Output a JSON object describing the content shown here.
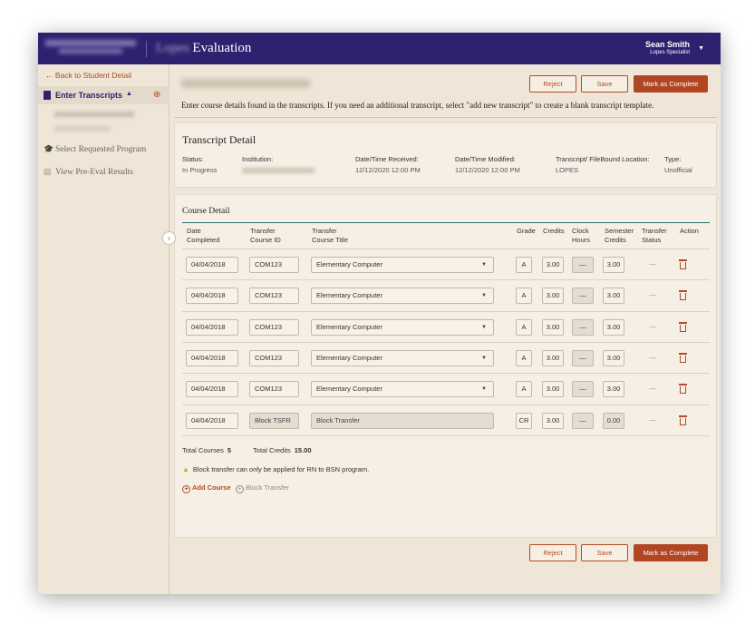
{
  "header": {
    "app_title": "Evaluation",
    "app_title_prefix": "Lopes",
    "user_name": "Sean Smith",
    "user_role": "Lopes Specialist"
  },
  "sidebar": {
    "back_label": "Back to Student Detail",
    "active_item": "Enter Transcripts",
    "items": [
      {
        "label": "Select Requested Program",
        "icon": "graduation-cap-icon"
      },
      {
        "label": "View Pre-Eval Results",
        "icon": "clipboard-icon"
      }
    ]
  },
  "actions": {
    "reject": "Reject",
    "save": "Save",
    "complete": "Mark as Complete"
  },
  "instructions": "Enter course details found in the transcripts. If you need an additional transcript, select \"add new transcript\" to create a blank transcript template.",
  "transcript_detail": {
    "title": "Transcript Detail",
    "fields": {
      "status_label": "Status:",
      "status_value": "In Progress",
      "institution_label": "Institution:",
      "received_label": "Date/Time Received:",
      "received_value": "12/12/2020 12:00 PM",
      "modified_label": "Date/Time Modified:",
      "modified_value": "12/12/2020 12:00 PM",
      "location_label": "Transcript/ FileBound Location:",
      "location_value": "LOPES",
      "type_label": "Type:",
      "type_value": "Unofficial"
    }
  },
  "course_detail": {
    "title": "Course Detail",
    "columns": [
      "Date\nCompleted",
      "Transfer\nCourse ID",
      "Transfer\nCourse Title",
      "Grade",
      "Credits",
      "Clock\nHours",
      "Semester\nCredits",
      "Transfer\nStatus",
      "Action"
    ],
    "rows": [
      {
        "date": "04/04/2018",
        "course_id": "COM123",
        "title": "Elementary Computer",
        "grade": "A",
        "credits": "3.00",
        "clock": "—",
        "semester": "3.00",
        "status": "—"
      },
      {
        "date": "04/04/2018",
        "course_id": "COM123",
        "title": "Elementary Computer",
        "grade": "A",
        "credits": "3.00",
        "clock": "—",
        "semester": "3.00",
        "status": "—"
      },
      {
        "date": "04/04/2018",
        "course_id": "COM123",
        "title": "Elementary Computer",
        "grade": "A",
        "credits": "3.00",
        "clock": "—",
        "semester": "3.00",
        "status": "—"
      },
      {
        "date": "04/04/2018",
        "course_id": "COM123",
        "title": "Elementary Computer",
        "grade": "A",
        "credits": "3.00",
        "clock": "—",
        "semester": "3.00",
        "status": "—"
      },
      {
        "date": "04/04/2018",
        "course_id": "COM123",
        "title": "Elementary Computer",
        "grade": "A",
        "credits": "3.00",
        "clock": "—",
        "semester": "3.00",
        "status": "—"
      },
      {
        "date": "04/04/2018",
        "course_id": "Block TSFR",
        "title": "Block Transfer",
        "grade": "CR",
        "credits": "3.00",
        "clock": "—",
        "semester": "0.00",
        "status": "—"
      }
    ],
    "total_courses_label": "Total Courses",
    "total_courses": "5",
    "total_credits_label": "Total Credits",
    "total_credits": "15.00",
    "warning": "Block transfer can only be applied for RN to BSN program.",
    "add_course": "Add Course",
    "block_transfer": "Block Transfer"
  },
  "colors": {
    "header": "#2d2270",
    "accent": "#b14623",
    "background": "#efe6d8",
    "teal": "#2a6d73"
  }
}
